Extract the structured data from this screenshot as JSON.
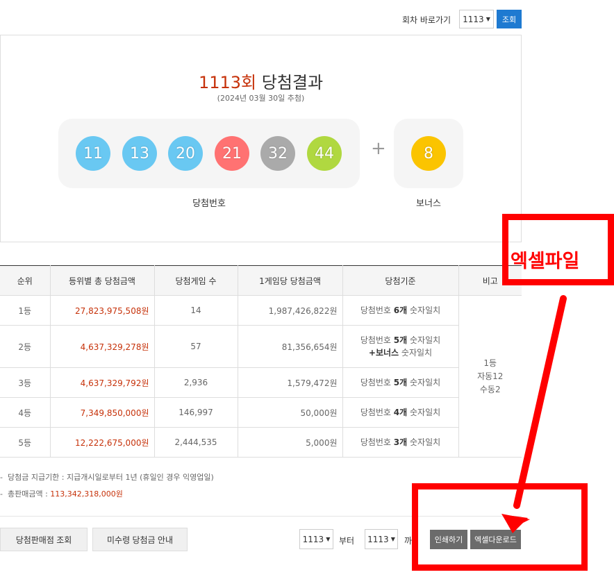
{
  "topbar": {
    "goto_label": "회차 바로가기",
    "round_value": "1113",
    "search_label": "조회"
  },
  "result": {
    "round": "1113회",
    "title_suffix": " 당첨결과",
    "date": "(2024년 03월 30일 추첨)",
    "numbers": [
      {
        "value": "11",
        "color": "#69c8f2"
      },
      {
        "value": "13",
        "color": "#69c8f2"
      },
      {
        "value": "20",
        "color": "#69c8f2"
      },
      {
        "value": "21",
        "color": "#ff7272"
      },
      {
        "value": "32",
        "color": "#aaaaaa"
      },
      {
        "value": "44",
        "color": "#b0d840"
      }
    ],
    "plus": "+",
    "bonus": {
      "value": "8",
      "color": "#fbc400"
    },
    "win_caption": "당첨번호",
    "bonus_caption": "보너스"
  },
  "table": {
    "headers": [
      "순위",
      "등위별 총 당첨금액",
      "당첨게임 수",
      "1게임당 당첨금액",
      "당첨기준",
      "비고"
    ],
    "rows": [
      {
        "rank": "1등",
        "total": "27,823,975,508원",
        "games": "14",
        "per_game": "1,987,426,822원",
        "crit_pre": "당첨번호 ",
        "crit_bold": "6개",
        "crit_post": " 숫자일치"
      },
      {
        "rank": "2등",
        "total": "4,637,329,278원",
        "games": "57",
        "per_game": "81,356,654원",
        "crit_pre": "당첨번호 ",
        "crit_bold": "5개",
        "crit_post": " 숫자일치",
        "crit_line2_bold": "+보너스",
        "crit_line2_post": " 숫자일치"
      },
      {
        "rank": "3등",
        "total": "4,637,329,792원",
        "games": "2,936",
        "per_game": "1,579,472원",
        "crit_pre": "당첨번호 ",
        "crit_bold": "5개",
        "crit_post": " 숫자일치"
      },
      {
        "rank": "4등",
        "total": "7,349,850,000원",
        "games": "146,997",
        "per_game": "50,000원",
        "crit_pre": "당첨번호 ",
        "crit_bold": "4개",
        "crit_post": " 숫자일치"
      },
      {
        "rank": "5등",
        "total": "12,222,675,000원",
        "games": "2,444,535",
        "per_game": "5,000원",
        "crit_pre": "당첨번호 ",
        "crit_bold": "3개",
        "crit_post": " 숫자일치"
      }
    ],
    "remark_lines": [
      "1등",
      "자동12",
      "수동2"
    ]
  },
  "notes": {
    "deadline": "당첨금 지급기한 : 지급개시일로부터 1년 (휴일인 경우 익영업일)",
    "sales_label": "총판매금액 : ",
    "sales_value": "113,342,318,000원"
  },
  "bottom": {
    "store_btn": "당첨판매점 조회",
    "unclaimed_btn": "미수령 당첨금 안내",
    "from_value": "1113",
    "from_label": "부터",
    "to_value": "1113",
    "to_label": "까",
    "print_btn": "인쇄하기",
    "excel_btn": "엑셀다운로드"
  },
  "annotation": {
    "label": "엑셀파일",
    "color": "#ff0000"
  }
}
